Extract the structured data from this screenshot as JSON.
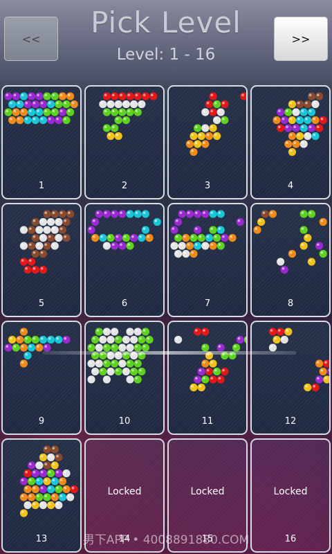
{
  "header": {
    "title": "Pick Level",
    "subtitle": "Level: 1 - 16",
    "prev_label": "<<",
    "next_label": ">>"
  },
  "colors": {
    "purple": "#9a2ad0",
    "cyan": "#18c6d8",
    "green": "#5ed21e",
    "orange": "#f08a18",
    "red": "#e41818",
    "white": "#e4e4e4",
    "yellow": "#f0c21a",
    "brown": "#8a4a2e"
  },
  "levels": [
    {
      "number": "1",
      "locked": false,
      "pattern": [
        "PPCPPGGOO",
        "CCPPPCGGO",
        "GOOCCGGPG",
        "OOCCCPPG"
      ]
    },
    {
      "number": "2",
      "locked": false,
      "pattern": [
        "..RRRRRRR",
        ".WWWWWW",
        "..GGGGG",
        "...GG",
        "..GG",
        "..YY"
      ]
    },
    {
      "number": "3",
      "locked": false,
      "pattern": [
        ".....R...R",
        "....RGR",
        "....WRW",
        ".....WG",
        "...GWY",
        "..YYOY",
        "..OYO",
        "..O"
      ]
    },
    {
      "number": "4",
      "locked": false,
      "pattern": [
        ".......BB",
        "....YBBW",
        "...PGWCC",
        "..OPYCCOR",
        "...RPPCPR",
        "....OYWC",
        "....OOW",
        "....Y"
      ]
    },
    {
      "number": "5",
      "locked": false,
      "pattern": [
        ".....BBBB",
        "...BWWWB",
        "..WBWWWB",
        "...BWBWB",
        "..WBWBW",
        "...BB",
        "..RR........R",
        "..RRR"
      ]
    },
    {
      "number": "6",
      "locked": false,
      "pattern": [
        ".PPPPCCC",
        "P.......C",
        "P......C",
        "OCGPGPCO",
        "..WPPG"
      ]
    },
    {
      "number": "7",
      "locked": false,
      "pattern": [
        ".PPPPCC",
        "P.......P",
        "P..P.GC",
        "GOGGCGPO",
        "WWOCWOG",
        "WWO"
      ]
    },
    {
      "number": "8",
      "locked": false,
      "pattern": [
        ".BO...GG",
        "Y.......O",
        "O.....G",
        "......Y",
        "......Y.P",
        "....O...G",
        "...W...Y",
        "...P"
      ]
    },
    {
      "number": "9",
      "locked": false,
      "pattern": [
        "..O.......O",
        "YOGGCCCP",
        "PGOCOP",
        "..C",
        "..O"
      ]
    },
    {
      "number": "10",
      "locked": false,
      "pattern": [
        ".GWW.WWG",
        "GWWGWWGG",
        "GWGGWWGG",
        "GGWWGWG",
        "WWGGWGG",
        "WGWGWGG",
        "W.W..WG"
      ]
    },
    {
      "number": "11",
      "locked": false,
      "pattern": [
        "...RR.....YY",
        "W.......PG",
        "....G.P.G",
        "....Y.GG",
        "....OY",
        "...PRGR",
        "...PGRR",
        "..YY"
      ]
    },
    {
      "number": "12",
      "locked": false,
      "pattern": [
        "..RRY.....YY",
        "..YW......OW",
        "..W.......PYG",
        "..........CPY",
        "........ORRR",
        "........OPO",
        "........PYYY",
        "......YR"
      ]
    },
    {
      "number": "13",
      "locked": false,
      "pattern": [
        ".....BB",
        "....YWB",
        "...PWBY",
        "..RPPGPW",
        "..PGCYCO",
        "..OOPCGOR",
        "..OOGGOCW",
        "..WYWYW",
        "..Y"
      ]
    },
    {
      "number": "14",
      "locked": true,
      "locked_label": "Locked"
    },
    {
      "number": "15",
      "locked": true,
      "locked_label": "Locked"
    },
    {
      "number": "16",
      "locked": true,
      "locked_label": "Locked"
    }
  ],
  "watermark": "男下APP • 4008891880.COM"
}
